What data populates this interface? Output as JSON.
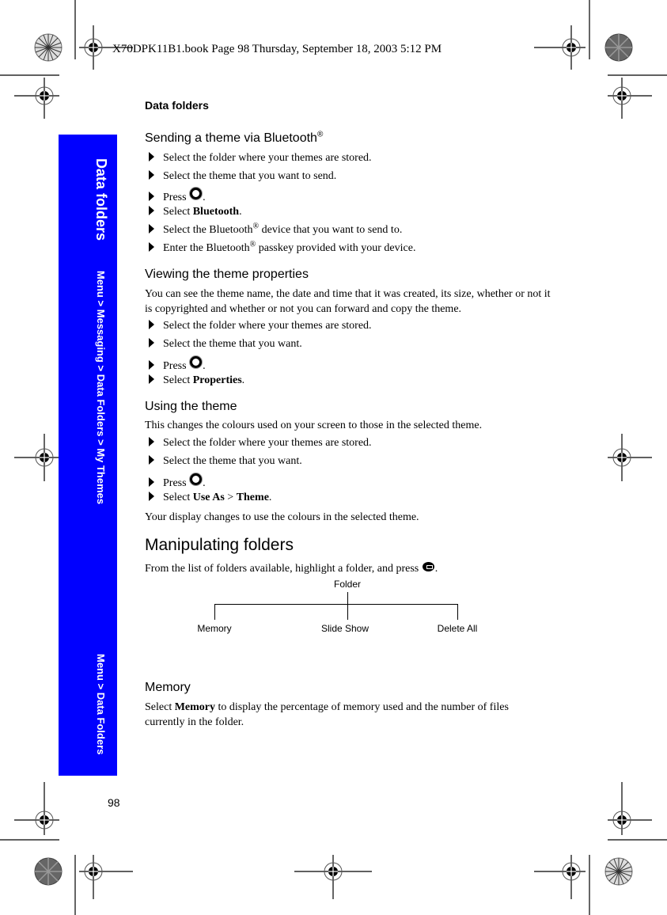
{
  "book_header": "X70DPK11B1.book  Page 98  Thursday, September 18, 2003  5:12 PM",
  "running_head": "Data folders",
  "page_number": "98",
  "side_tab": {
    "title": "Data folders",
    "path_1": "Menu > Messaging > Data Folders > My Themes",
    "path_2": "Menu > Data Folders",
    "color": "#0000ff"
  },
  "sections": {
    "sending": {
      "heading": "Sending a theme via Bluetooth",
      "heading_sup": "®",
      "steps": [
        {
          "text": "Select the folder where your themes are stored."
        },
        {
          "text": "Select the theme that you want to send."
        },
        {
          "pre": "Press ",
          "icon": "select-key-icon",
          "post": "."
        },
        {
          "pre": "Select ",
          "bold": "Bluetooth",
          "post": "."
        },
        {
          "pre": "Select the Bluetooth",
          "sup": "®",
          "post": " device that you want to send to."
        },
        {
          "pre": "Enter the Bluetooth",
          "sup": "®",
          "post": " passkey provided with your device."
        }
      ]
    },
    "viewing": {
      "heading": "Viewing the theme properties",
      "intro": "You can see the theme name, the date and time that it was created, its size, whether or not it is copyrighted and whether or not you can forward and copy the theme.",
      "steps": [
        {
          "text": "Select the folder where your themes are stored."
        },
        {
          "text": "Select the theme that you want."
        },
        {
          "pre": "Press ",
          "icon": "select-key-icon",
          "post": "."
        },
        {
          "pre": "Select ",
          "bold": "Properties",
          "post": "."
        }
      ]
    },
    "using": {
      "heading": "Using the theme",
      "intro": "This changes the colours used on your screen to those in the selected theme.",
      "steps": [
        {
          "text": "Select the folder where your themes are stored."
        },
        {
          "text": "Select the theme that you want."
        },
        {
          "pre": "Press ",
          "icon": "select-key-icon",
          "post": "."
        },
        {
          "pre": "Select ",
          "bold": "Use As",
          "mid": " > ",
          "bold2": "Theme",
          "post": "."
        }
      ],
      "outro": "Your display changes to use the colours in the selected theme."
    },
    "manipulating": {
      "heading": "Manipulating folders",
      "intro_pre": "From the list of folders available, highlight a folder, and press ",
      "intro_icon": "menu-key-icon",
      "intro_post": ".",
      "diagram": {
        "root": "Folder",
        "children": [
          "Memory",
          "Slide Show",
          "Delete All"
        ]
      }
    },
    "memory": {
      "heading": "Memory",
      "text_pre": "Select ",
      "text_bold": "Memory",
      "text_post": " to display the percentage of memory used and the number of files currently in the folder."
    }
  }
}
